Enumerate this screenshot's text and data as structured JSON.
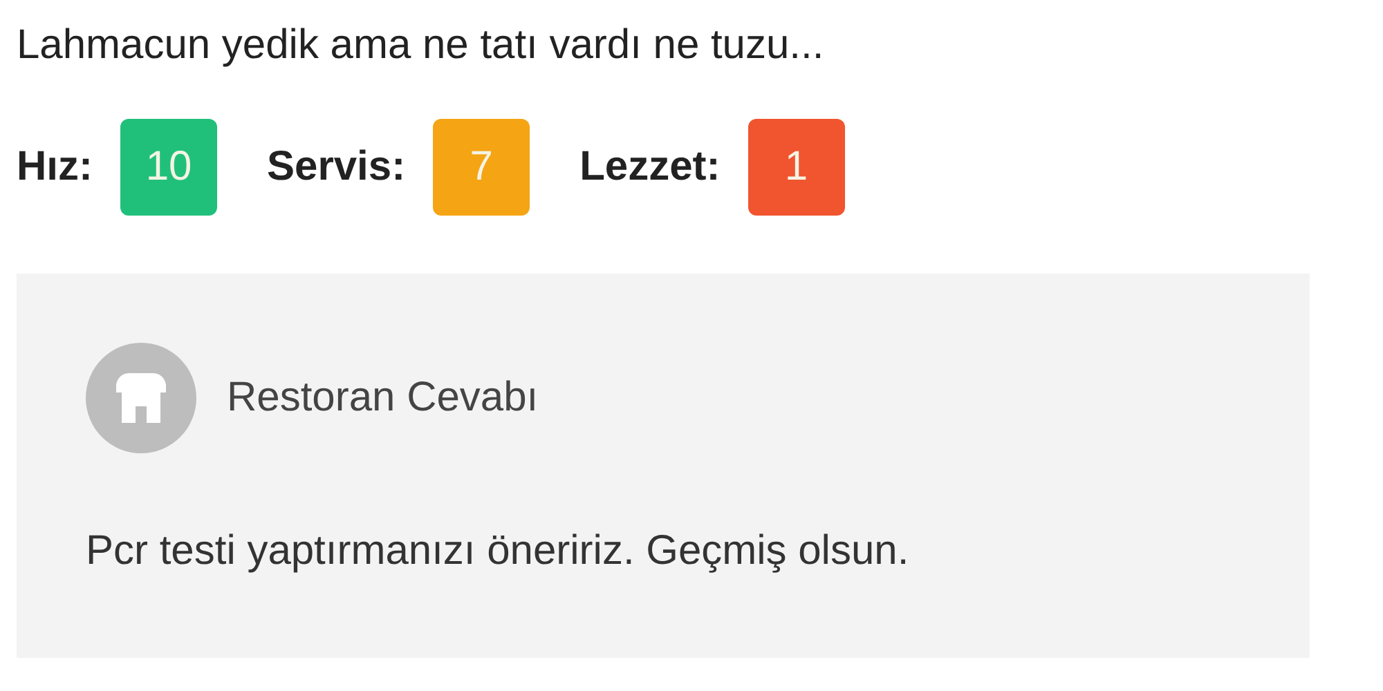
{
  "review": {
    "comment": "Lahmacun yedik ama ne tatı vardı ne tuzu...",
    "scores": [
      {
        "label": "Hız:",
        "value": "10",
        "color": "#21c07a"
      },
      {
        "label": "Servis:",
        "value": "7",
        "color": "#f5a414"
      },
      {
        "label": "Lezzet:",
        "value": "1",
        "color": "#f0552f"
      }
    ]
  },
  "reply": {
    "title": "Restoran Cevabı",
    "text": "Pcr testi yaptırmanızı öneririz. Geçmiş olsun."
  }
}
